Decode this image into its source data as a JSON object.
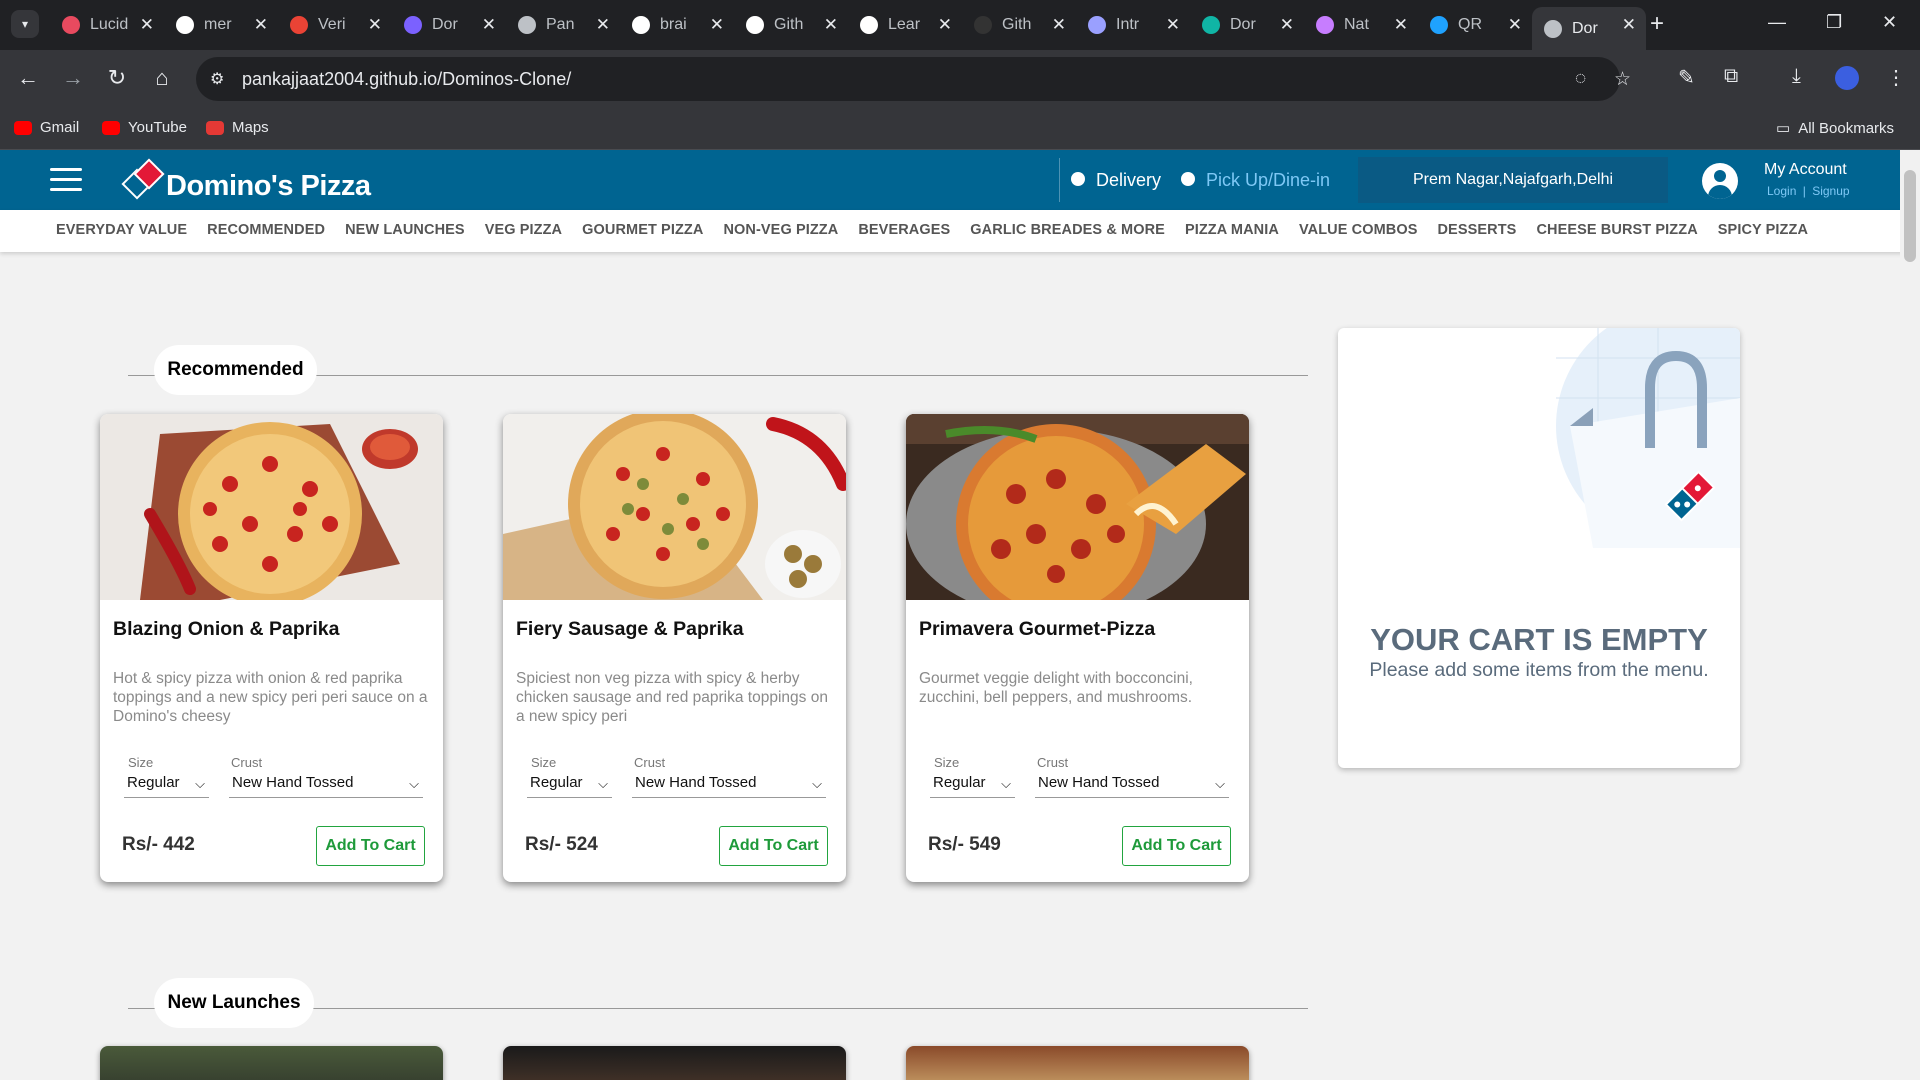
{
  "browser": {
    "tabs": [
      {
        "title": "Lucid",
        "icon": "lucid-icon",
        "color": "#e84a5f"
      },
      {
        "title": "mer",
        "icon": "github-icon",
        "color": "#ffffff"
      },
      {
        "title": "Veri",
        "icon": "gmail-icon",
        "color": "#ea4335"
      },
      {
        "title": "Dor",
        "icon": "meta-icon",
        "color": "#7b61ff"
      },
      {
        "title": "Pan",
        "icon": "globe-icon",
        "color": "#bdc1c6"
      },
      {
        "title": "brai",
        "icon": "github-icon",
        "color": "#ffffff"
      },
      {
        "title": "Gith",
        "icon": "codolio-icon",
        "color": "#ffffff"
      },
      {
        "title": "Lear",
        "icon": "codolio-icon",
        "color": "#ffffff"
      },
      {
        "title": "Gith",
        "icon": "github-icon",
        "color": "#333333"
      },
      {
        "title": "Intr",
        "icon": "bars-icon",
        "color": "#9aa0ff"
      },
      {
        "title": "Dor",
        "icon": "diamond-icon",
        "color": "#10b5a5"
      },
      {
        "title": "Nat",
        "icon": "nat-icon",
        "color": "#c77dff"
      },
      {
        "title": "QR",
        "icon": "qr-icon",
        "color": "#1fa2ff"
      },
      {
        "title": "Dor",
        "icon": "globe-icon",
        "color": "#bdc1c6"
      }
    ],
    "url": "pankajjaat2004.github.io/Dominos-Clone/",
    "bookmarks": [
      {
        "label": "Gmail",
        "icon": "youtube-icon",
        "color": "#ff0000"
      },
      {
        "label": "YouTube",
        "icon": "youtube-icon",
        "color": "#ff0000"
      },
      {
        "label": "Maps",
        "icon": "maps-icon",
        "color": "#e53935"
      }
    ],
    "all_bookmarks": "All Bookmarks"
  },
  "header": {
    "brand": "Domino's Pizza",
    "delivery": "Delivery",
    "pickup": "Pick Up/Dine-in",
    "location": "Prem Nagar,Najafgarh,Delhi",
    "account_title": "My Account",
    "login": "Login",
    "separator": "|",
    "signup": "Signup"
  },
  "categories": [
    "EVERYDAY VALUE",
    "RECOMMENDED",
    "NEW LAUNCHES",
    "VEG PIZZA",
    "GOURMET PIZZA",
    "NON-VEG PIZZA",
    "BEVERAGES",
    "GARLIC BREADES & MORE",
    "PIZZA MANIA",
    "VALUE COMBOS",
    "DESSERTS",
    "CHEESE BURST PIZZA",
    "SPICY PIZZA"
  ],
  "sections": {
    "recommended": "Recommended",
    "new_launches": "New Launches"
  },
  "products": [
    {
      "name": "Blazing Onion & Paprika",
      "desc": "Hot & spicy pizza with onion & red paprika toppings and a new spicy peri peri sauce on a Domino's cheesy",
      "size_label": "Size",
      "size": "Regular",
      "crust_label": "Crust",
      "crust": "New Hand Tossed",
      "price": "Rs/- 442",
      "button": "Add To Cart"
    },
    {
      "name": "Fiery Sausage & Paprika",
      "desc": "Spiciest non veg pizza with spicy & herby chicken sausage and red paprika toppings on a new spicy peri",
      "size_label": "Size",
      "size": "Regular",
      "crust_label": "Crust",
      "crust": "New Hand Tossed",
      "price": "Rs/- 524",
      "button": "Add To Cart"
    },
    {
      "name": "Primavera Gourmet-Pizza",
      "desc": "Gourmet veggie delight with bocconcini, zucchini, bell peppers, and mushrooms.",
      "size_label": "Size",
      "size": "Regular",
      "crust_label": "Crust",
      "crust": "New Hand Tossed",
      "price": "Rs/- 549",
      "button": "Add To Cart"
    }
  ],
  "cart": {
    "title": "YOUR CART IS EMPTY",
    "subtitle": "Please add some items from the menu."
  },
  "colors": {
    "brand_blue": "#006491",
    "brand_red": "#e31837",
    "add_green": "#22a43f"
  }
}
